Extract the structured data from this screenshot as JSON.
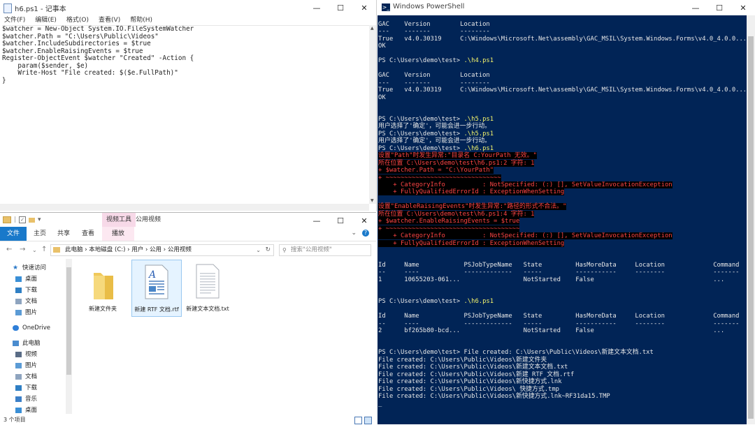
{
  "notepad": {
    "title": "h6.ps1 - 记事本",
    "menu": [
      "文件(F)",
      "编辑(E)",
      "格式(O)",
      "查看(V)",
      "帮助(H)"
    ],
    "content": "$watcher = New-Object System.IO.FileSystemWatcher\n$watcher.Path = \"C:\\Users\\Public\\Videos\"\n$watcher.IncludeSubdirectories = $true\n$watcher.EnableRaisingEvents = $true\nRegister-ObjectEvent $watcher \"Created\" -Action {\n    param($sender, $e)\n    Write-Host \"File created: $($e.FullPath)\"\n}"
  },
  "explorer": {
    "title": "公用视频",
    "context_tab": "视频工具",
    "ribbon": {
      "file": "文件",
      "home": "主页",
      "share": "共享",
      "view": "查看",
      "play": "播放"
    },
    "address": "此电脑 › 本地磁盘 (C:) › 用户 › 公用 › 公用视频",
    "search_placeholder": "搜索\"公用视频\"",
    "nav": [
      {
        "label": "快速访问",
        "icon": "star-icon",
        "level": 0,
        "pinned": false
      },
      {
        "label": "桌面",
        "icon": "desktop-icon",
        "level": 1,
        "pinned": true
      },
      {
        "label": "下载",
        "icon": "download-icon",
        "level": 1,
        "pinned": true
      },
      {
        "label": "文档",
        "icon": "document-icon",
        "level": 1,
        "pinned": true
      },
      {
        "label": "图片",
        "icon": "picture-icon",
        "level": 1,
        "pinned": true
      },
      {
        "label": "OneDrive",
        "icon": "cloud-icon",
        "level": 0,
        "pinned": false
      },
      {
        "label": "此电脑",
        "icon": "computer-icon",
        "level": 0,
        "pinned": false
      },
      {
        "label": "视频",
        "icon": "video-icon",
        "level": 1,
        "pinned": false
      },
      {
        "label": "图片",
        "icon": "picture-icon",
        "level": 1,
        "pinned": false
      },
      {
        "label": "文档",
        "icon": "document-icon",
        "level": 1,
        "pinned": false
      },
      {
        "label": "下载",
        "icon": "download-icon",
        "level": 1,
        "pinned": false
      },
      {
        "label": "音乐",
        "icon": "music-icon",
        "level": 1,
        "pinned": false
      },
      {
        "label": "桌面",
        "icon": "desktop-icon",
        "level": 1,
        "pinned": false
      }
    ],
    "files": [
      {
        "name": "新建文件夹",
        "icon": "folder-icon"
      },
      {
        "name": "新建 RTF 文档.rtf",
        "icon": "rtf-document-icon"
      },
      {
        "name": "新建文本文档.txt",
        "icon": "text-document-icon"
      }
    ],
    "status": "3 个项目"
  },
  "powershell": {
    "title": "Windows PowerShell"
  },
  "colors": {
    "ps_background": "#012456",
    "ps_command": "#f4f46b",
    "ps_error": "#ff4545",
    "explorer_file_tab": "#1979ca",
    "explorer_context_tab": "#f7d9e8"
  }
}
